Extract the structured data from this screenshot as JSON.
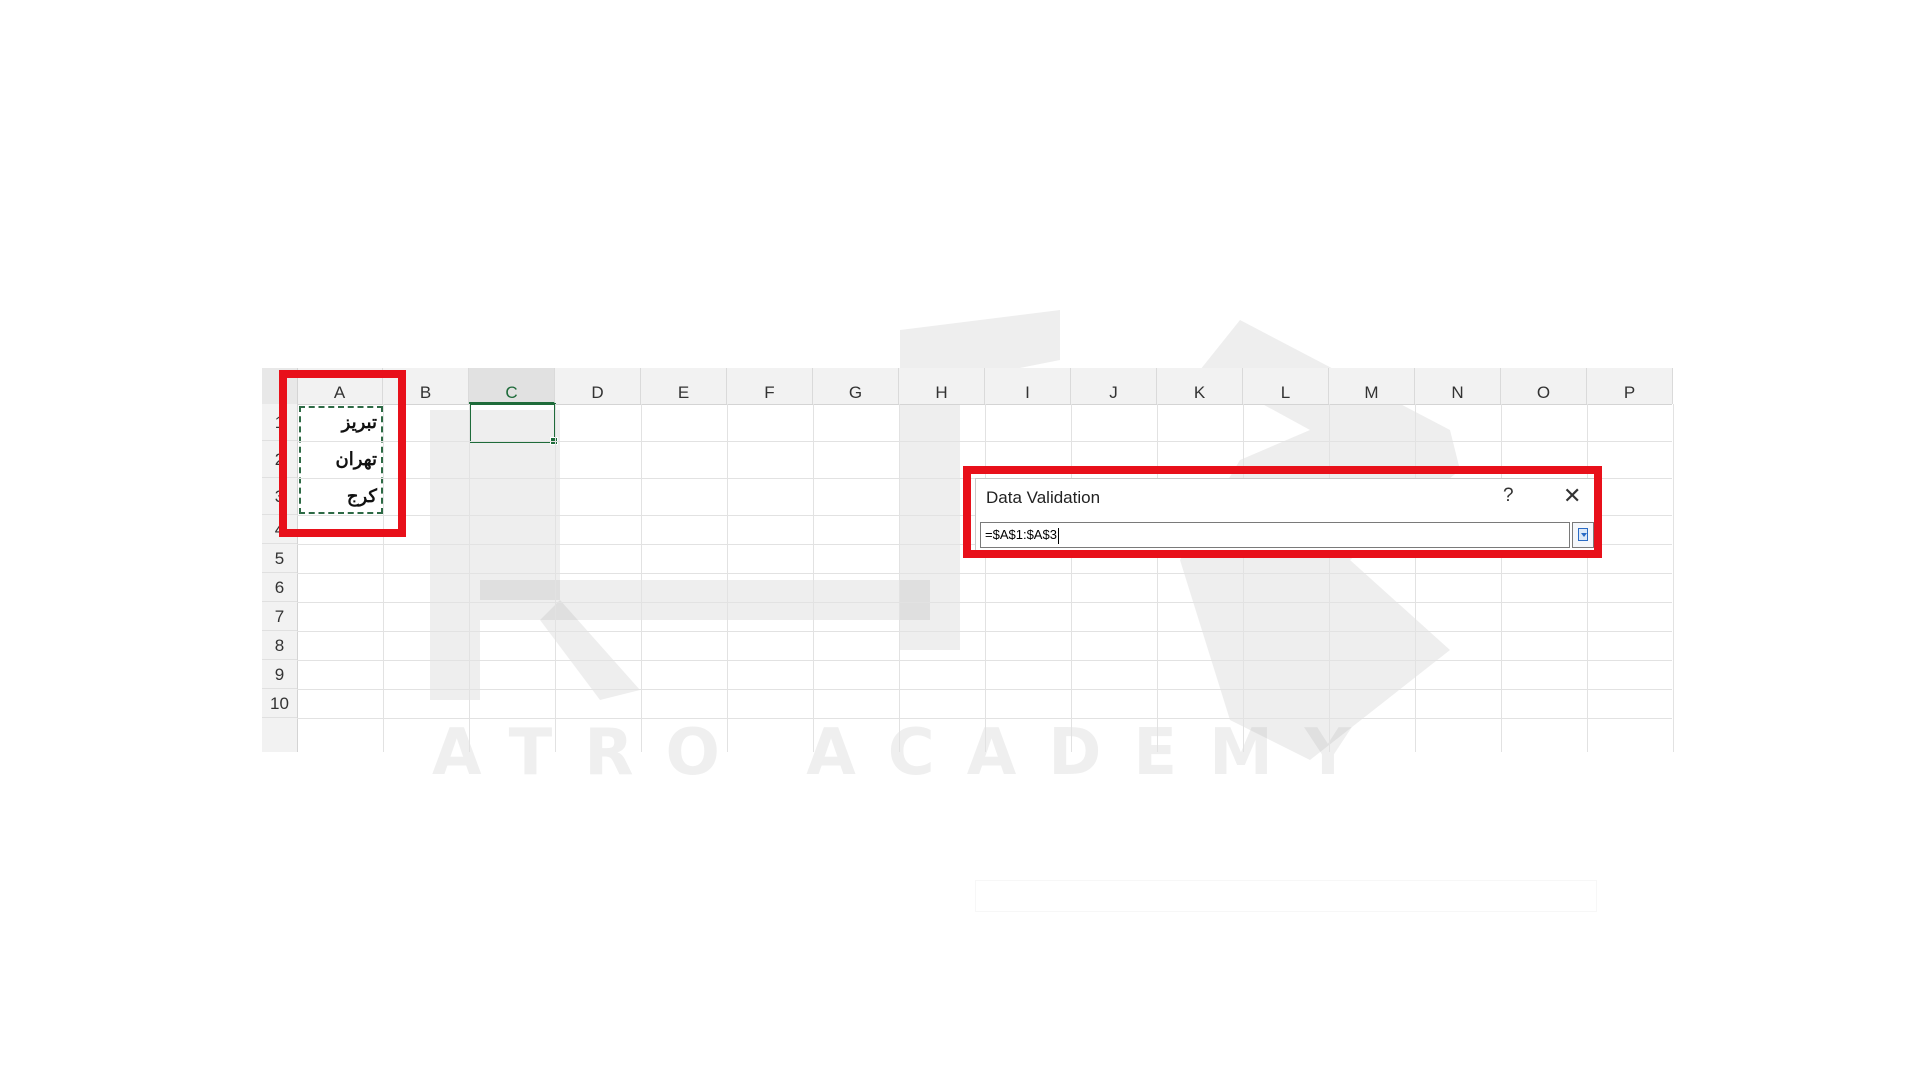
{
  "sheet": {
    "columns": [
      "A",
      "B",
      "C",
      "D",
      "E",
      "F",
      "G",
      "H",
      "I",
      "J",
      "K",
      "L",
      "M",
      "N",
      "O",
      "P"
    ],
    "selected_column": "C",
    "rows": [
      "1",
      "2",
      "3",
      "4",
      "5",
      "6",
      "7",
      "8",
      "9",
      "10"
    ],
    "column_a_values": [
      "تبریز",
      "تهران",
      "کرج"
    ]
  },
  "dialog": {
    "title": "Data Validation",
    "help_label": "?",
    "close_icon": "close-icon",
    "formula_value": "=$A$1:$A$3",
    "collapse_icon": "expand-dialog-icon"
  },
  "watermark": {
    "text": "ATRO ACADEMY"
  },
  "colors": {
    "highlight_red": "#e8101a",
    "excel_green": "#1e6b3a",
    "marquee_green": "#2d6a45"
  }
}
